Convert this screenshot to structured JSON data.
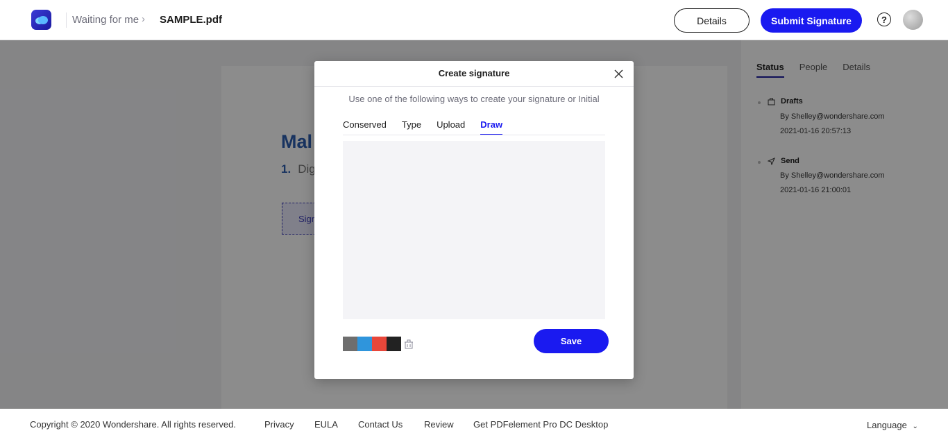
{
  "header": {
    "breadcrumb_parent": "Waiting for me",
    "breadcrumb_current": "SAMPLE.pdf",
    "details_label": "Details",
    "submit_label": "Submit Signature",
    "help_glyph": "?"
  },
  "document": {
    "title_fragment": "Mal",
    "line_number": "1.",
    "line_fragment": "Dig",
    "sign_field_fragment": "Sign"
  },
  "right_panel": {
    "tabs": [
      "Status",
      "People",
      "Details"
    ],
    "timeline": [
      {
        "title": "Drafts",
        "icon": "briefcase-icon",
        "by": "By Shelley@wondershare.com",
        "time": "2021-01-16 20:57:13"
      },
      {
        "title": "Send",
        "icon": "send-icon",
        "by": "By Shelley@wondershare.com",
        "time": "2021-01-16 21:00:01"
      }
    ]
  },
  "modal": {
    "title": "Create signature",
    "subtitle": "Use one of the following ways to create your signature or Initial",
    "tabs": [
      "Conserved",
      "Type",
      "Upload",
      "Draw"
    ],
    "active_tab": "Draw",
    "colors": [
      "#6e6e6e",
      "#2f95dc",
      "#e8473a",
      "#222222"
    ],
    "save_label": "Save"
  },
  "footer": {
    "copyright": "Copyright © 2020 Wondershare. All rights reserved.",
    "links": [
      "Privacy",
      "EULA",
      "Contact Us",
      "Review",
      "Get PDFelement Pro DC Desktop"
    ],
    "language_label": "Language"
  }
}
